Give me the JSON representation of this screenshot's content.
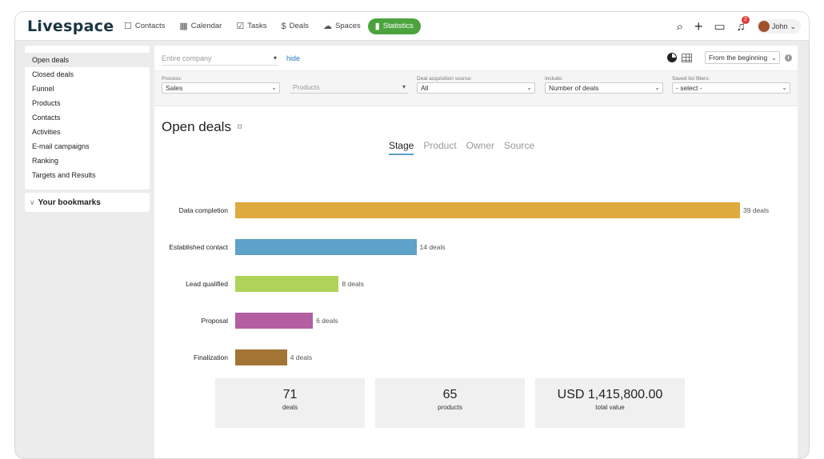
{
  "app": {
    "logo": "Livespace"
  },
  "nav": [
    {
      "label": "Contacts",
      "icon": "contacts-icon",
      "glyph": "☐"
    },
    {
      "label": "Calendar",
      "icon": "calendar-icon",
      "glyph": "▦"
    },
    {
      "label": "Tasks",
      "icon": "tasks-icon",
      "glyph": "☑"
    },
    {
      "label": "Deals",
      "icon": "dollar-icon",
      "glyph": "$"
    },
    {
      "label": "Spaces",
      "icon": "cloud-icon",
      "glyph": "☁"
    },
    {
      "label": "Statistics",
      "icon": "bar-chart-icon",
      "glyph": "▮",
      "active": true
    }
  ],
  "header": {
    "notification_count": "2",
    "user_name": "John"
  },
  "sidebar": {
    "items": [
      "Open deals",
      "Closed deals",
      "Funnel",
      "Products",
      "Contacts",
      "Activities",
      "E-mail campaigns",
      "Ranking",
      "Targets and Results"
    ],
    "active_index": 0,
    "bookmarks_label": "Your bookmarks"
  },
  "toolbar": {
    "company_placeholder": "Entire company",
    "hide_label": "hide",
    "range_value": "From the beginning"
  },
  "filters": {
    "process": {
      "label": "Process:",
      "value": "Sales"
    },
    "products": {
      "label": "",
      "value": "Products"
    },
    "source": {
      "label": "Deal acquisition source:",
      "value": "All"
    },
    "include": {
      "label": "Include:",
      "value": "Number of deals"
    },
    "saved": {
      "label": "Saved list filters:",
      "value": "- select -"
    }
  },
  "page": {
    "title": "Open deals"
  },
  "tabs": [
    "Stage",
    "Product",
    "Owner",
    "Source"
  ],
  "active_tab": 0,
  "chart_data": {
    "type": "bar",
    "orientation": "horizontal",
    "categories": [
      "Data completion",
      "Established contact",
      "Lead qualified",
      "Proposal",
      "Finalization"
    ],
    "values": [
      39,
      14,
      8,
      6,
      4
    ],
    "value_labels": [
      "39 deals",
      "14 deals",
      "8 deals",
      "6 deals",
      "4 deals"
    ],
    "colors": [
      "#dfaa3d",
      "#5ea1c9",
      "#afd35a",
      "#b25ea0",
      "#a27535"
    ],
    "xlim": [
      0,
      39
    ]
  },
  "stats": [
    {
      "value": "71",
      "caption": "deals"
    },
    {
      "value": "65",
      "caption": "products"
    },
    {
      "value": "USD 1,415,800.00",
      "caption": "total value"
    }
  ]
}
